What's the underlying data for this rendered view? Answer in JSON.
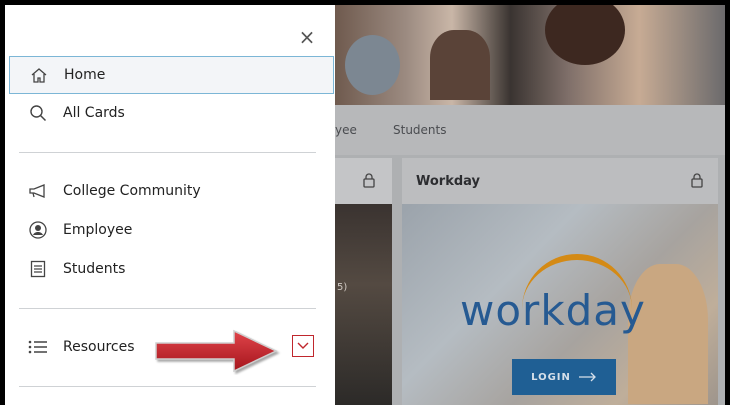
{
  "drawer": {
    "close_label": "×",
    "items": [
      {
        "label": "Home",
        "icon": "home-icon",
        "active": true
      },
      {
        "label": "All Cards",
        "icon": "search-icon"
      },
      {
        "label": "College Community",
        "icon": "megaphone-icon"
      },
      {
        "label": "Employee",
        "icon": "user-circle-icon"
      },
      {
        "label": "Students",
        "icon": "document-icon"
      },
      {
        "label": "Resources",
        "icon": "list-icon"
      }
    ]
  },
  "background": {
    "tabs": [
      "yee",
      "Students"
    ],
    "card_left_partial_text": "5)",
    "card": {
      "title": "Workday",
      "logo_text": "workday",
      "login_label": "LOGIN"
    }
  },
  "colors": {
    "accent_red": "#c0272d",
    "active_border": "#7cb6d6",
    "workday_blue": "#265a92",
    "workday_orange": "#d48a15"
  }
}
